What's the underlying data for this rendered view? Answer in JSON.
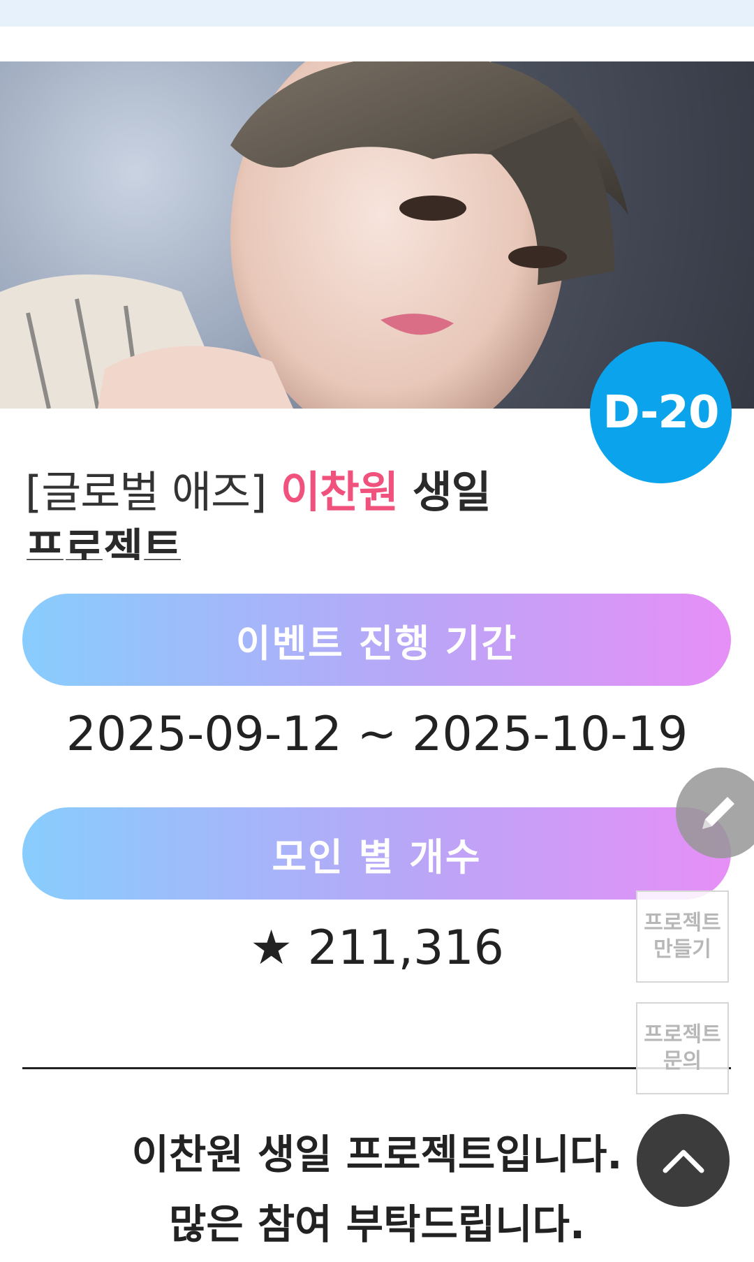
{
  "dday_badge": "D-20",
  "title": {
    "prefix": "[글로벌 애즈]",
    "name": "이찬원",
    "line1_suffix": "생일",
    "line2": "프로젝트"
  },
  "event_period": {
    "label": "이벤트 진행 기간",
    "value": "2025-09-12 ~ 2025-10-19"
  },
  "stars": {
    "label": "모인 별 개수",
    "value": "★ 211,316"
  },
  "description": {
    "line1": "이찬원 생일 프로젝트입니다.",
    "line2": "많은 참여 부탁드립니다."
  },
  "side_buttons": {
    "create_line1": "프로젝트",
    "create_line2": "만들기",
    "inquiry_line1": "프로젝트",
    "inquiry_line2": "문의"
  },
  "icons": {
    "edit": "pencil-icon",
    "scroll_top": "chevron-up-icon"
  },
  "colors": {
    "dday_badge": "#0aa3ec",
    "name_highlight": "#f0527d",
    "pill_gradient_start": "#88cdfd",
    "pill_gradient_end": "#e68ff6"
  }
}
